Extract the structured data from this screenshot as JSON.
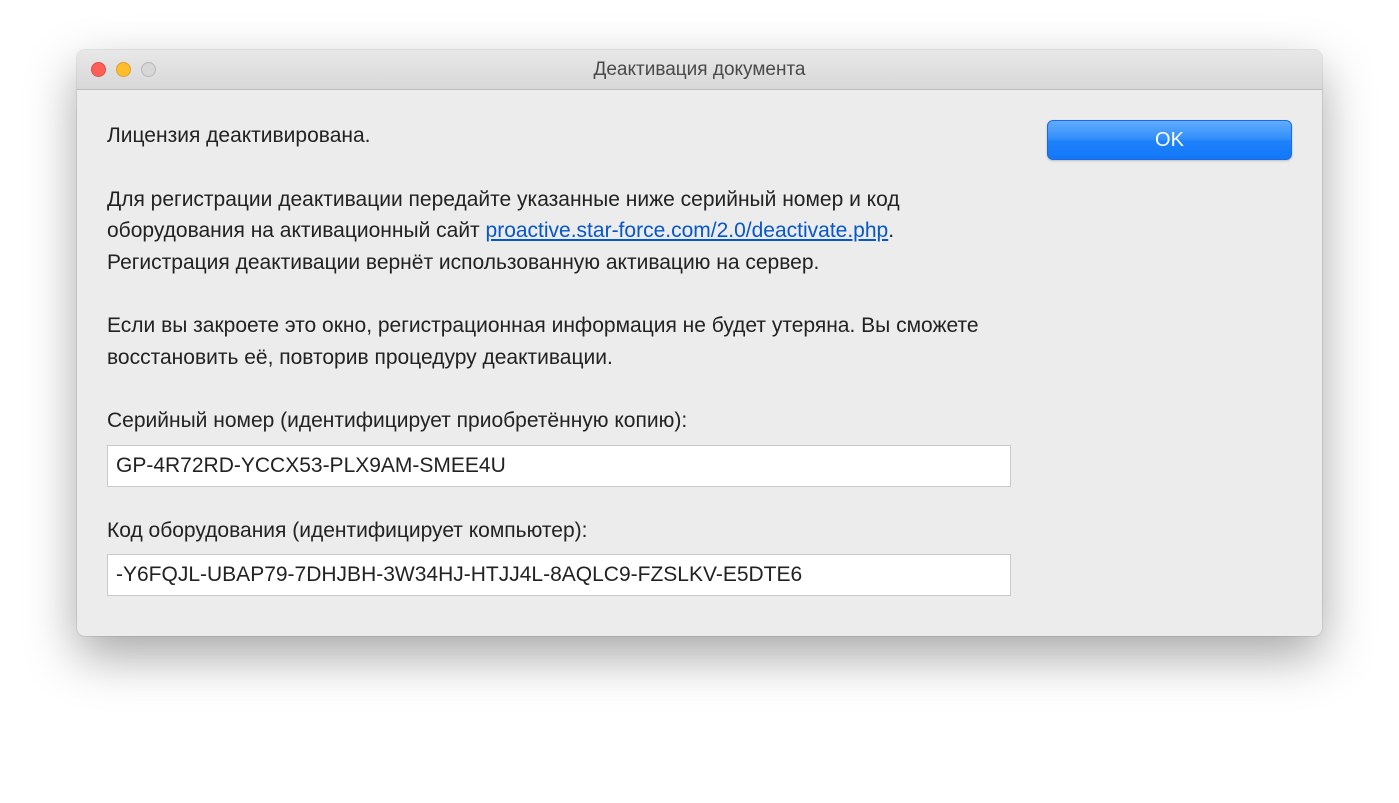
{
  "window": {
    "title": "Деактивация документа"
  },
  "dialog": {
    "deactivated": "Лицензия деактивирована.",
    "para2_before_link": "Для регистрации деактивации передайте указанные ниже серийный номер и код оборудования на активационный сайт ",
    "link_text": "proactive.star-force.com/2.0/deactivate.php",
    "para2_after_link": ". Регистрация деактивации вернёт использованную активацию на сервер.",
    "para3": "Если вы закроете это окно, регистрационная информация не будет утеряна. Вы сможете восстановить её, повторив процедуру деактивации.",
    "serial_label": "Серийный номер (идентифицирует приобретённую копию):",
    "serial_value": "GP-4R72RD-YCCX53-PLX9AM-SMEE4U",
    "hw_label": "Код оборудования (идентифицирует компьютер):",
    "hw_value": "-Y6FQJL-UBAP79-7DHJBH-3W34HJ-HTJJ4L-8AQLC9-FZSLKV-E5DTE6"
  },
  "buttons": {
    "ok": "OK"
  }
}
